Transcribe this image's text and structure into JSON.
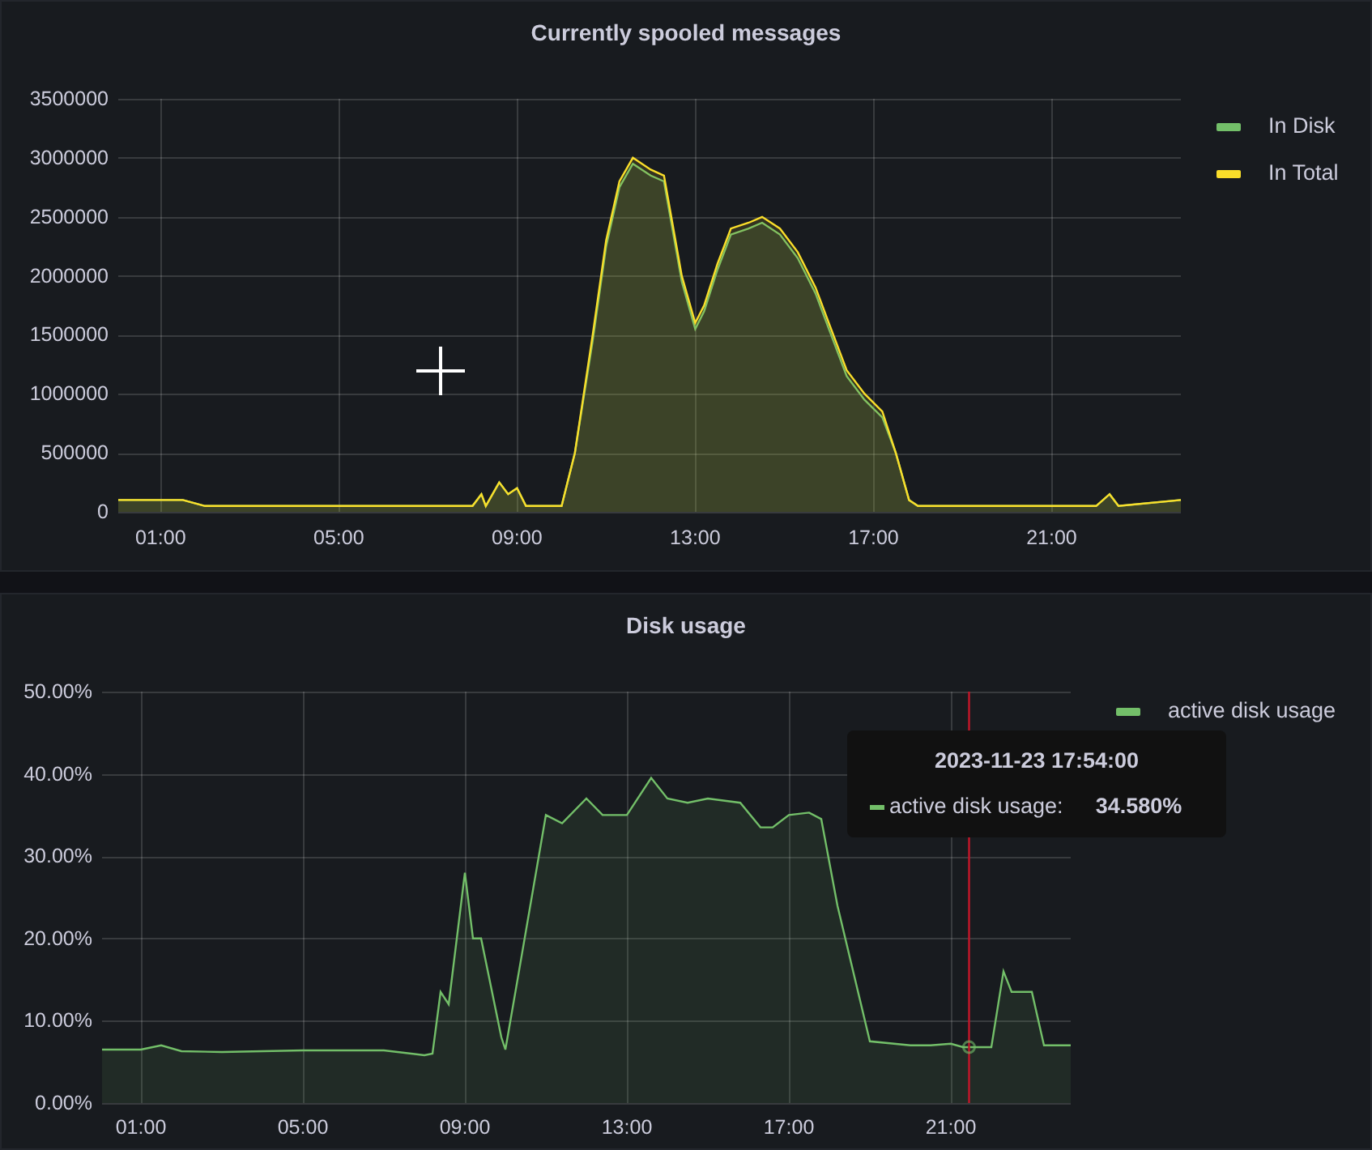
{
  "panels": [
    {
      "title": "Currently spooled messages",
      "chart_data": {
        "type": "area",
        "xlim": [
          0.05,
          23.9
        ],
        "ylim": [
          0,
          3500000
        ],
        "xticks": [
          {
            "value": 1,
            "label": "01:00"
          },
          {
            "value": 5,
            "label": "05:00"
          },
          {
            "value": 9,
            "label": "09:00"
          },
          {
            "value": 13,
            "label": "13:00"
          },
          {
            "value": 17,
            "label": "17:00"
          },
          {
            "value": 21,
            "label": "21:00"
          }
        ],
        "yticks": [
          0,
          500000,
          1000000,
          1500000,
          2000000,
          2500000,
          3000000,
          3500000
        ],
        "grid": true,
        "x": [
          0.05,
          1,
          1.5,
          2,
          2.3,
          3,
          5,
          7,
          8,
          8.2,
          8.3,
          8.6,
          8.8,
          9,
          9.2,
          10,
          10.3,
          10.7,
          11,
          11.3,
          11.6,
          12,
          12.3,
          12.7,
          13,
          13.2,
          13.5,
          13.8,
          14.2,
          14.5,
          14.9,
          15.3,
          15.7,
          16,
          16.4,
          16.8,
          17.2,
          17.5,
          17.8,
          18,
          20,
          22,
          22.3,
          22.5,
          23.9
        ],
        "series": [
          {
            "name": "In Disk",
            "color": "#73bf69",
            "values": [
              100000,
              100000,
              100000,
              50000,
              50000,
              50000,
              50000,
              50000,
              50000,
              150000,
              50000,
              250000,
              150000,
              200000,
              50000,
              50000,
              500000,
              1450000,
              2250000,
              2750000,
              2950000,
              2850000,
              2800000,
              1950000,
              1550000,
              1700000,
              2050000,
              2350000,
              2400000,
              2450000,
              2350000,
              2150000,
              1850000,
              1550000,
              1150000,
              950000,
              800000,
              500000,
              100000,
              50000,
              50000,
              50000,
              150000,
              50000,
              100000
            ]
          },
          {
            "name": "In Total",
            "color": "#fade2a",
            "values": [
              100000,
              100000,
              100000,
              50000,
              50000,
              50000,
              50000,
              50000,
              50000,
              150000,
              50000,
              250000,
              150000,
              200000,
              50000,
              50000,
              500000,
              1500000,
              2300000,
              2800000,
              3000000,
              2900000,
              2850000,
              2000000,
              1600000,
              1750000,
              2100000,
              2400000,
              2450000,
              2500000,
              2400000,
              2200000,
              1900000,
              1600000,
              1200000,
              1000000,
              850000,
              500000,
              100000,
              50000,
              50000,
              50000,
              150000,
              50000,
              100000
            ]
          }
        ]
      }
    },
    {
      "title": "Disk usage",
      "chart_data": {
        "type": "area",
        "xlim": [
          0.04,
          23.96
        ],
        "ylim": [
          0,
          50
        ],
        "xticks": [
          {
            "value": 1,
            "label": "01:00"
          },
          {
            "value": 5,
            "label": "05:00"
          },
          {
            "value": 9,
            "label": "09:00"
          },
          {
            "value": 13,
            "label": "13:00"
          },
          {
            "value": 17,
            "label": "17:00"
          },
          {
            "value": 21,
            "label": "21:00"
          }
        ],
        "yticks": [
          {
            "value": 0,
            "label": "0.00%"
          },
          {
            "value": 10,
            "label": "10.00%"
          },
          {
            "value": 20,
            "label": "20.00%"
          },
          {
            "value": 30,
            "label": "30.00%"
          },
          {
            "value": 40,
            "label": "40.00%"
          },
          {
            "value": 50,
            "label": "50.00%"
          }
        ],
        "grid": true,
        "x": [
          0.04,
          1,
          1.5,
          2,
          3,
          5,
          7,
          8,
          8.2,
          8.4,
          8.6,
          8.8,
          9,
          9.2,
          9.4,
          9.9,
          10,
          10.3,
          11,
          11.4,
          12,
          12.4,
          13,
          13.6,
          14,
          14.5,
          15,
          15.8,
          16.3,
          16.6,
          17,
          17.5,
          17.8,
          18.2,
          19,
          20,
          20.5,
          21,
          21.3,
          22,
          22.3,
          22.5,
          23,
          23.3,
          23.96
        ],
        "series": [
          {
            "name": "active disk usage",
            "color": "#73bf69",
            "values": [
              6.5,
              6.5,
              7,
              6.3,
              6.2,
              6.4,
              6.4,
              5.8,
              6,
              13.5,
              12,
              20,
              28,
              20,
              20,
              8,
              6.5,
              15,
              35,
              34,
              37,
              35,
              35,
              39.5,
              37,
              36.5,
              37,
              36.5,
              33.5,
              33.5,
              35,
              35.3,
              34.5,
              24,
              7.5,
              7,
              7,
              7.2,
              6.8,
              6.8,
              16,
              13.5,
              13.5,
              7,
              7
            ]
          }
        ],
        "ref_lines": [
          {
            "axis": "x",
            "value": 21.45,
            "color": "#c4162a"
          }
        ]
      },
      "tooltip": {
        "time": "2023-11-23 17:54:00",
        "label": "active disk usage:",
        "value": "34.580%"
      }
    }
  ]
}
